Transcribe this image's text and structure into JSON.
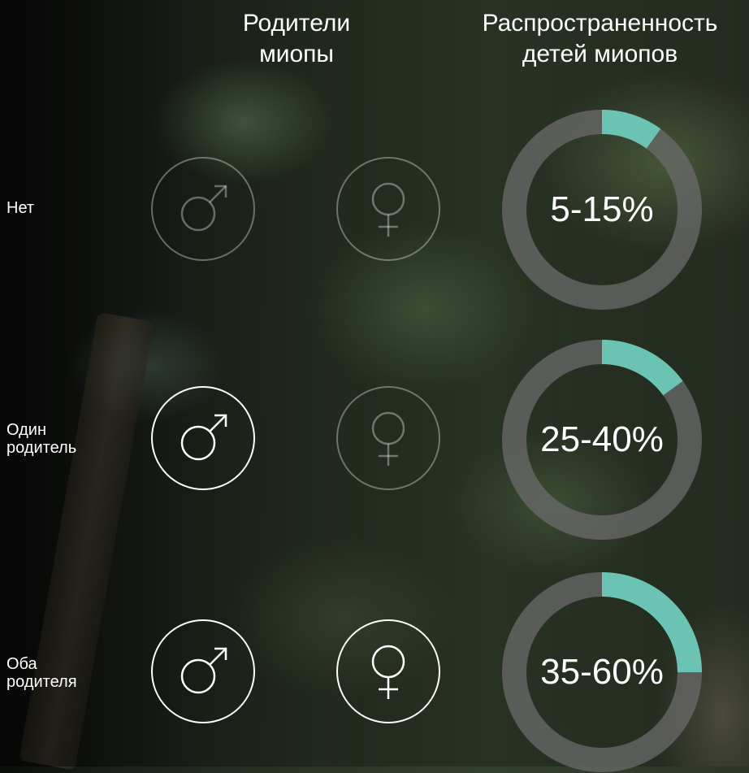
{
  "headers": {
    "parents_line1": "Родители",
    "parents_line2": "миопы",
    "prevalence_line1": "Распространенность",
    "prevalence_line2": "детей миопов"
  },
  "rows": [
    {
      "label_line1": "Нет",
      "label_line2": "",
      "father_active": false,
      "mother_active": false,
      "range_text": "5-15%",
      "range_low_pct": 5,
      "range_high_pct": 15
    },
    {
      "label_line1": "Один",
      "label_line2": "родитель",
      "father_active": true,
      "mother_active": false,
      "range_text": "25-40%",
      "range_low_pct": 25,
      "range_high_pct": 40
    },
    {
      "label_line1": "Оба",
      "label_line2": "родителя",
      "father_active": true,
      "mother_active": true,
      "range_text": "35-60%",
      "range_low_pct": 35,
      "range_high_pct": 60
    }
  ],
  "icons": {
    "father": "male-symbol-icon",
    "mother": "female-symbol-icon"
  },
  "colors": {
    "accent": "#6bc4b3",
    "track": "#6b6b6b",
    "active": "#ffffff",
    "inactive": "rgba(255,255,255,0.35)"
  }
}
